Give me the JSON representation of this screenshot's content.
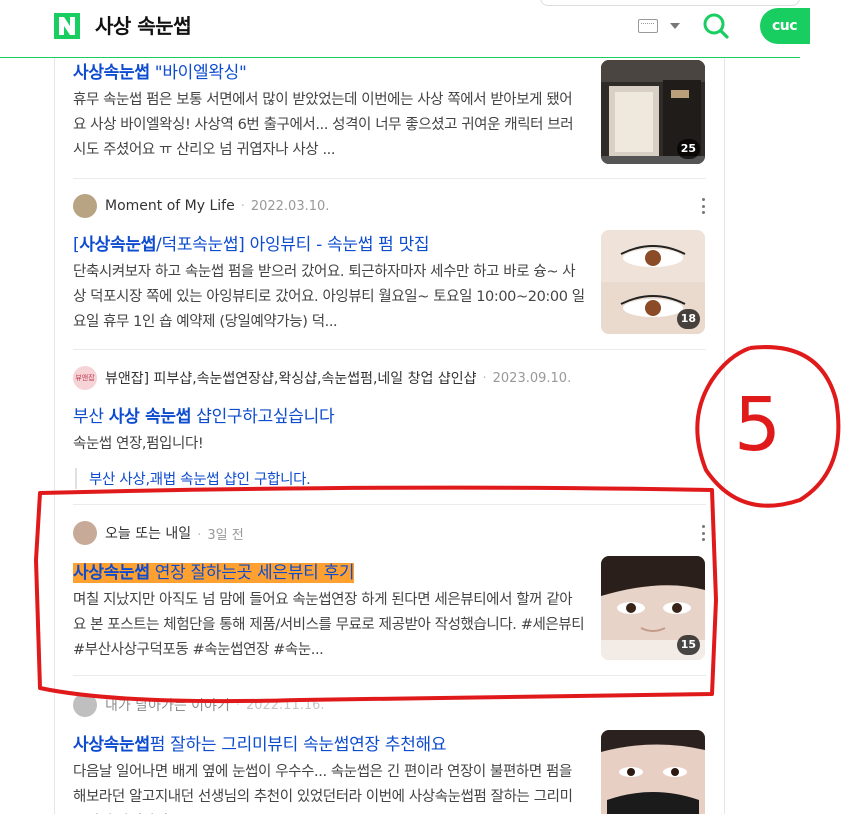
{
  "header": {
    "query": "사상 속눈썹",
    "login_label": "cuc"
  },
  "posts": [
    {
      "title_bold": "사상속눈썹",
      "title_rest": " \"바이엘왁싱\"",
      "desc": "휴무 속눈썹 펌은 보통 서면에서 많이 받았었는데 이번에는 사상 쪽에서 받아보게 됐어요 사상 바이엘왁싱! 사상역 6번 출구에서... 성격이 너무 좋으셨고 귀여운 캐릭터 브러시도 주셨어요 ㅠ 산리오 넘 귀엽자나 사상 ...",
      "count": "25"
    },
    {
      "author": "Moment of My Life",
      "date": "2022.03.10.",
      "title_pre": "[",
      "title_bold": "사상속눈썹",
      "title_rest": "/덕포속눈썹] 아잉뷰티 - 속눈썹 펌 맛집",
      "desc": "단축시켜보자 하고 속눈썹 펌을 받으러 갔어요. 퇴근하자마자 세수만 하고 바로 슝~ 사상 덕포시장 쪽에 있는 아잉뷰티로 갔어요. 아잉뷰티 월요일~ 토요일 10:00~20:00 일요일 휴무 1인 숍 예약제 (당일예약가능) 덕...",
      "count": "18"
    },
    {
      "author": "뷰앤잡] 피부샵,속눈썹연장샵,왁싱샵,속눈썹펌,네일 창업 샵인샵",
      "date": "2023.09.10.",
      "avatar_text": "뷰앤잡",
      "title_pre": "부산 ",
      "title_bold": "사상 속눈썹",
      "title_rest": " 샵인구하고싶습니다",
      "desc": "속눈썹 연장,펌입니다!",
      "quote": "부산 사상,괘법 속눈썹 샵인 구합니다."
    },
    {
      "author": "오늘 또는 내일",
      "date": "3일 전",
      "title_bold": "사상속눈썹",
      "title_rest": " 연장 잘하는곳 세은뷰티 후기",
      "desc": "며칠 지났지만 아직도 넘 맘에 들어요 속눈썹연장 하게 된다면 세은뷰티에서 할꺼 같아요 본 포스트는 체험단을 통해 제품/서비스를 무료로 제공받아 작성했습니다. #세은뷰티 #부산사상구덕포동 #속눈썹연장 #속눈...",
      "count": "15"
    },
    {
      "author": "내가 날아가는 이야기",
      "date": "2022.11.16.",
      "title_bold": "사상속눈썹",
      "title_rest": "펌 잘하는 그리미뷰티 속눈썹연장 추천해요",
      "desc": "다음날 일어나면 배게 옆에 눈썹이 우수수... 속눈썹은 긴 편이라 연장이 불편하면 펌을 해보라던 알고지내던 선생님의 추천이 있었던터라 이번에 사상속눈썹펌 잘하는 그리미뷰티에 다녀왔어요 ..."
    }
  ],
  "annotation": {
    "number": "5",
    "color": "#e0191b"
  }
}
